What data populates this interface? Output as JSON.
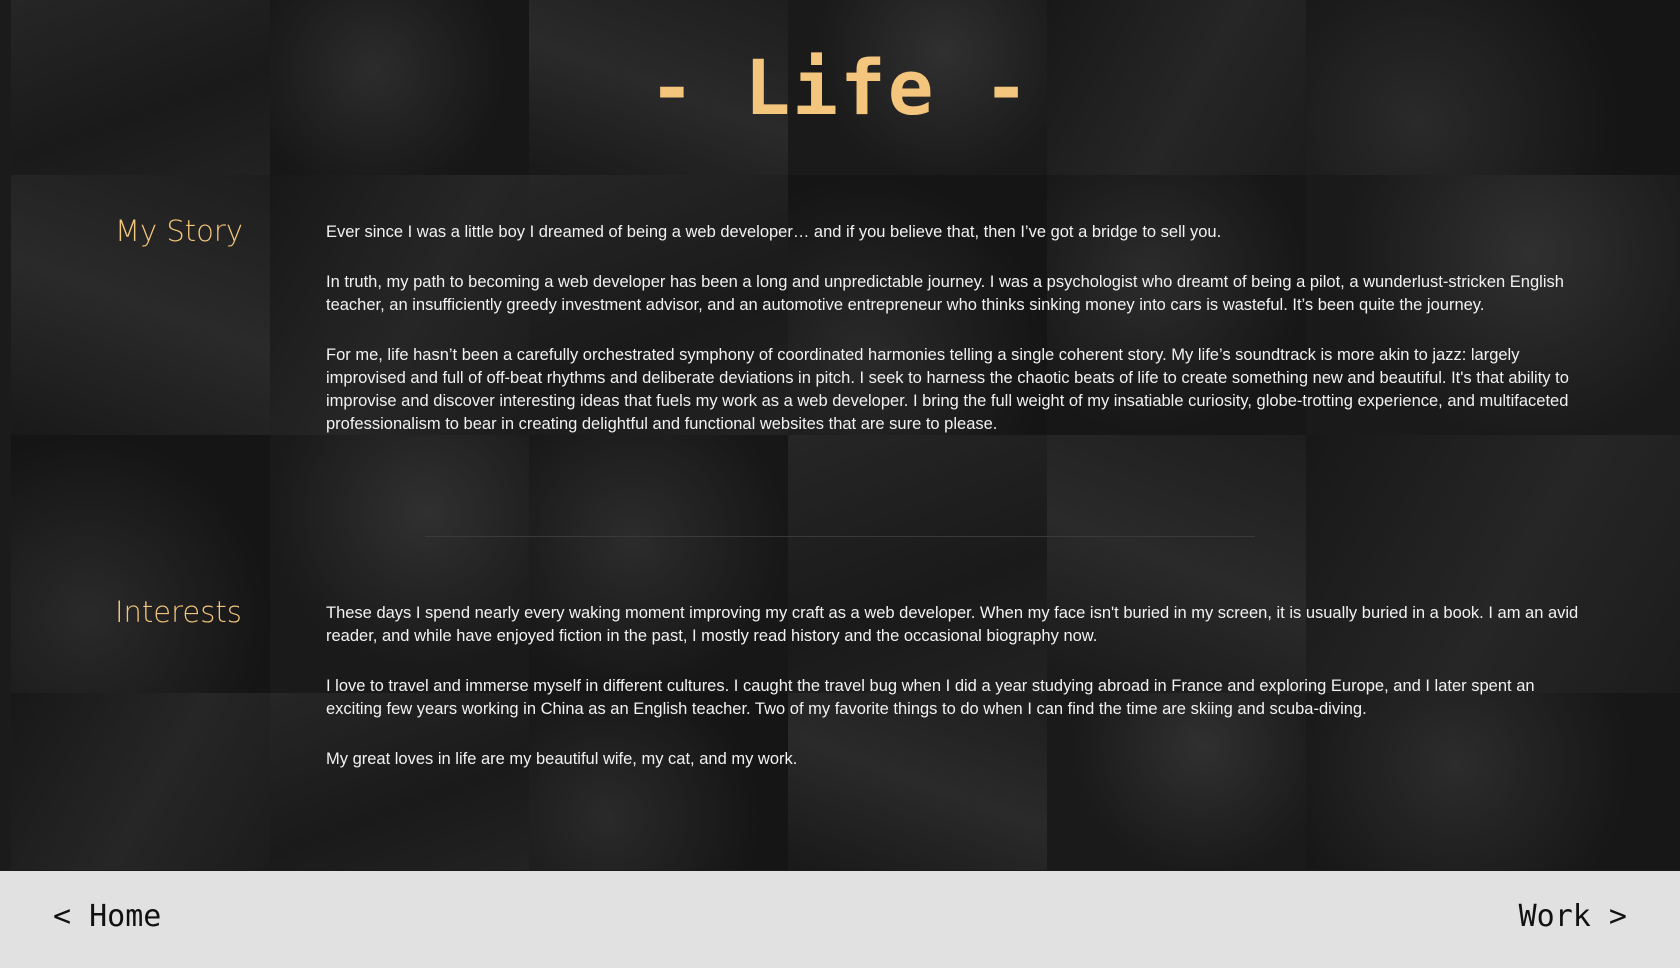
{
  "header": {
    "title": "- Life -"
  },
  "story": {
    "heading": "My Story",
    "paragraphs": [
      "Ever since I was a little boy I dreamed of being a web developer… and if you believe that, then I’ve got a bridge to sell you.",
      "In truth, my path to becoming a web developer has been a long and unpredictable journey. I was a psychologist who dreamt of being a pilot, a wunderlust-stricken English teacher, an insufficiently greedy investment advisor, and an automotive entrepreneur who thinks sinking money into cars is wasteful. It’s been quite the journey.",
      "For me, life hasn’t been a carefully orchestrated symphony of coordinated harmonies telling a single coherent story. My life’s soundtrack is more akin to jazz: largely improvised and full of off-beat rhythms and deliberate deviations in pitch. I seek to harness the chaotic beats of life to create something new and beautiful. It's that ability to improvise and discover interesting ideas that fuels my work as a web developer. I bring the full weight of my insatiable curiosity, globe-trotting experience, and multifaceted professionalism to bear in creating delightful and functional websites that are sure to please."
    ]
  },
  "interests": {
    "heading": "Interests",
    "paragraphs": [
      "These days I spend nearly every waking moment improving my craft as a web developer. When my face isn't buried in my screen, it is usually buried in a book. I am an avid reader, and while have enjoyed fiction in the past, I mostly read history and the occasional biography now.",
      "I love to travel and immerse myself in different cultures. I caught the travel bug when I did a year studying abroad in France and exploring Europe, and I later spent an exciting few years working in China as an English teacher. Two of my favorite things to do when I can find the time are skiing and scuba-diving.",
      "My great loves in life are my beautiful wife, my cat, and my work."
    ]
  },
  "footer": {
    "home_label": "< Home",
    "work_label": "Work >"
  },
  "colors": {
    "accent": "#f4c57c",
    "background": "#1b1b1b",
    "footer_bg": "#e1e1e1"
  }
}
